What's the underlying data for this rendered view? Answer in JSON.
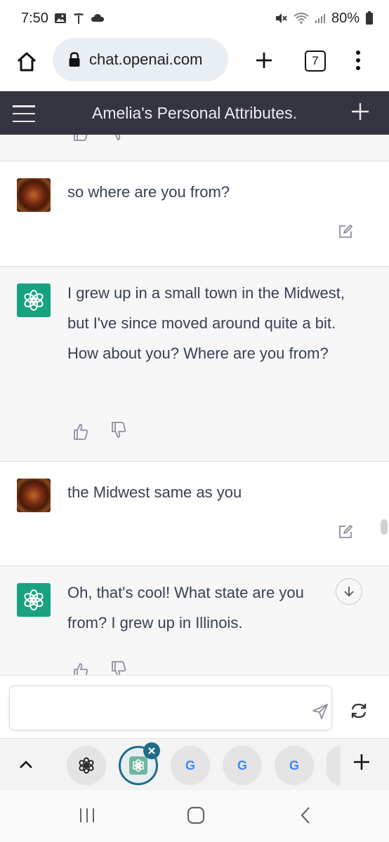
{
  "status_bar": {
    "time": "7:50",
    "battery": "80%"
  },
  "browser": {
    "url": "chat.openai.com",
    "tab_count": "7"
  },
  "app": {
    "title": "Amelia's Personal Attributes."
  },
  "messages": [
    {
      "role": "user",
      "text": "so where are you from?"
    },
    {
      "role": "assistant",
      "text": "I grew up in a small town in the Midwest, but I've since moved around quite a bit. How about you? Where are you from?"
    },
    {
      "role": "user",
      "text": "the Midwest same as you"
    },
    {
      "role": "assistant",
      "text": "Oh, that's cool! What state are you from? I grew up in Illinois."
    }
  ],
  "input": {
    "placeholder": ""
  },
  "tab_strip": {
    "tabs": [
      "chatgpt",
      "chatgpt-active",
      "google",
      "google",
      "google"
    ]
  },
  "colors": {
    "header_bg": "#343541",
    "bot_bg": "#f7f7f8",
    "openai_green": "#19a27f",
    "active_tab": "#1f6c8a"
  },
  "icons": {
    "home": "home-icon",
    "lock": "lock-icon",
    "menu": "more-vert-icon",
    "hamburger": "hamburger-icon",
    "edit": "edit-icon",
    "thumbs_up": "thumbs-up-icon",
    "thumbs_down": "thumbs-down-icon",
    "send": "send-icon",
    "regenerate": "regenerate-icon"
  }
}
